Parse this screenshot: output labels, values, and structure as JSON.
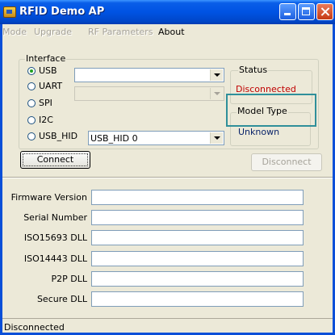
{
  "window": {
    "title": "RFID Demo AP"
  },
  "menu": [
    {
      "label": "Mode",
      "enabled": false
    },
    {
      "label": "Upgrade",
      "enabled": false
    },
    {
      "label": "RF Parameters",
      "enabled": false
    },
    {
      "label": "About",
      "enabled": true
    }
  ],
  "interface": {
    "group_label": "Interface",
    "options": [
      {
        "label": "USB",
        "checked": true
      },
      {
        "label": "UART",
        "checked": false
      },
      {
        "label": "SPI",
        "checked": false
      },
      {
        "label": "I2C",
        "checked": false
      },
      {
        "label": "USB_HID",
        "checked": false
      }
    ],
    "usb_combo_value": "",
    "uart_combo_value": "",
    "usb_hid_combo_value": "USB_HID 0"
  },
  "status": {
    "group_label": "Status",
    "value": "Disconnected",
    "value_color": "#c00000"
  },
  "model_type": {
    "group_label": "Model Type",
    "value": "Unknown",
    "value_color": "#0a246a"
  },
  "buttons": {
    "connect": "Connect",
    "disconnect": "Disconnect"
  },
  "info_fields": [
    {
      "label": "Firmware Version",
      "value": ""
    },
    {
      "label": "Serial Number",
      "value": ""
    },
    {
      "label": "ISO15693 DLL",
      "value": ""
    },
    {
      "label": "ISO14443 DLL",
      "value": ""
    },
    {
      "label": "P2P DLL",
      "value": ""
    },
    {
      "label": "Secure DLL",
      "value": ""
    }
  ],
  "statusbar": {
    "text": "Disconnected"
  }
}
